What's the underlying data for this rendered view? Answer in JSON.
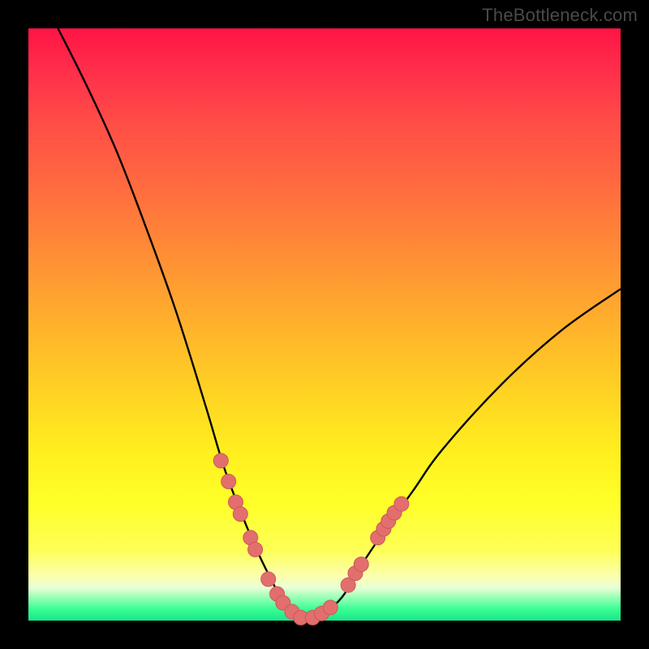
{
  "watermark": "TheBottleneck.com",
  "colors": {
    "frame": "#000000",
    "curve": "#000000",
    "marker_fill": "#e26f6d",
    "marker_stroke": "#cc5957",
    "grad_top": "#ff1445",
    "grad_bottom": "#18e589"
  },
  "chart_data": {
    "type": "line",
    "title": "",
    "xlabel": "",
    "ylabel": "",
    "xlim": [
      0,
      100
    ],
    "ylim": [
      0,
      100
    ],
    "curve": {
      "comment": "V-shaped bottleneck curve; y ~ bottleneck %, x ~ relative component score. Minimum near x≈46, y≈0.",
      "x": [
        5,
        10,
        15,
        20,
        25,
        30,
        33,
        36,
        39,
        42,
        44,
        46,
        48,
        50,
        53,
        56,
        60,
        65,
        70,
        80,
        90,
        100
      ],
      "y": [
        100,
        90,
        79,
        66,
        52,
        36,
        26,
        18,
        11,
        5,
        1.5,
        0.3,
        0.3,
        1.3,
        4,
        9,
        15,
        22,
        29,
        40,
        49,
        56
      ]
    },
    "markers": {
      "comment": "Highlighted GPU/CPU sample points clustered in lower region of the curve (salmon dots).",
      "points": [
        {
          "x": 32.5,
          "y": 27
        },
        {
          "x": 33.8,
          "y": 23.5
        },
        {
          "x": 35.0,
          "y": 20
        },
        {
          "x": 35.8,
          "y": 18
        },
        {
          "x": 37.5,
          "y": 14
        },
        {
          "x": 38.3,
          "y": 12
        },
        {
          "x": 40.5,
          "y": 7
        },
        {
          "x": 42.0,
          "y": 4.5
        },
        {
          "x": 43.0,
          "y": 3
        },
        {
          "x": 44.5,
          "y": 1.5
        },
        {
          "x": 46.0,
          "y": 0.5
        },
        {
          "x": 48.0,
          "y": 0.5
        },
        {
          "x": 49.5,
          "y": 1.2
        },
        {
          "x": 51.0,
          "y": 2.2
        },
        {
          "x": 54.0,
          "y": 6
        },
        {
          "x": 55.2,
          "y": 8
        },
        {
          "x": 56.2,
          "y": 9.5
        },
        {
          "x": 59.0,
          "y": 14
        },
        {
          "x": 60.0,
          "y": 15.5
        },
        {
          "x": 60.8,
          "y": 16.8
        },
        {
          "x": 61.8,
          "y": 18.2
        },
        {
          "x": 63.0,
          "y": 19.7
        }
      ],
      "radius": 9
    }
  }
}
